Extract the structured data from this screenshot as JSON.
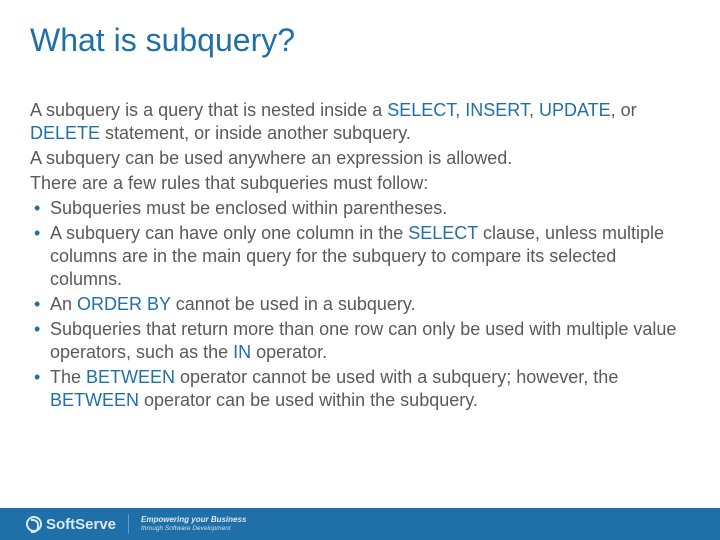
{
  "title": "What is subquery?",
  "p1": {
    "a": "A subquery is a query that is nested inside a ",
    "k1": "SELECT",
    "b": ", ",
    "k2": "INSERT",
    "c": ", ",
    "k3": "UPDATE",
    "d": ", or ",
    "k4": "DELETE",
    "e": " statement, or inside another subquery."
  },
  "p2": "A subquery can be used anywhere an expression is allowed.",
  "p3": "There are a few rules that subqueries must follow:",
  "bullets": {
    "b1": "Subqueries must be enclosed within parentheses.",
    "b2": {
      "a": "A subquery can have only one column in the ",
      "k1": "SELECT",
      "b": " clause, unless multiple columns are in the main query for the subquery to compare its selected columns."
    },
    "b3": {
      "a": "An ",
      "k1": "ORDER BY",
      "b": " cannot be used in a subquery."
    },
    "b4": {
      "a": "Subqueries that return more than one row can only be used with multiple value operators, such as the ",
      "k1": "IN",
      "b": " operator."
    },
    "b5": {
      "a": "The ",
      "k1": "BETWEEN",
      "b": " operator cannot be used with a subquery; however, the ",
      "k2": "BETWEEN",
      "c": " operator can be used within the subquery."
    }
  },
  "footer": {
    "brand": "SoftServe",
    "tag1": "Empowering your Business",
    "tag2": "through Software Development"
  }
}
